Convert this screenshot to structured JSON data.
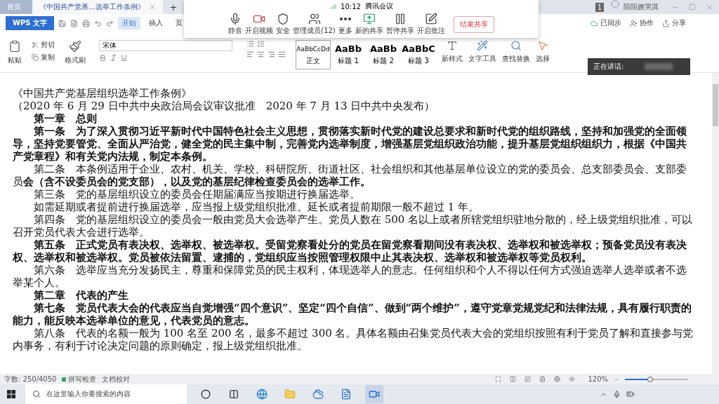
{
  "title_bar": {
    "tabs": [
      {
        "label": "首页",
        "selected": false
      },
      {
        "label": "《中国共产党基...选举工作条例》",
        "selected": true
      }
    ],
    "new_tab": "+",
    "notification_count": "1",
    "user_name": "陌陌嫂哭淇"
  },
  "ribbon": {
    "app_menu": "WPS 文字",
    "tabs": [
      {
        "label": "开始",
        "selected": true
      },
      {
        "label": "插入",
        "selected": false
      },
      {
        "label": "页",
        "selected": false
      }
    ],
    "cloud_actions": [
      {
        "label": "已同步",
        "kind": "sync"
      },
      {
        "label": "协作",
        "kind": "collab"
      },
      {
        "label": "分享",
        "kind": "share"
      }
    ],
    "clipboard": {
      "paste": "粘贴",
      "cut": "剪切",
      "copy": "复制",
      "format_painter": "格式刷"
    },
    "font_name": "宋体",
    "styles": [
      {
        "preview": "AaBbCcDd",
        "label": "正文",
        "selected": true
      },
      {
        "preview": "AaBb",
        "label": "标题 1",
        "selected": false
      },
      {
        "preview": "AaBb",
        "label": "标题 2",
        "selected": false
      },
      {
        "preview": "AaBbC",
        "label": "标题 3",
        "selected": false
      }
    ],
    "tools": [
      {
        "label": "新样式",
        "kind": "style"
      },
      {
        "label": "文字工具",
        "kind": "text"
      },
      {
        "label": "查找替换",
        "kind": "find"
      },
      {
        "label": "选择",
        "kind": "select"
      }
    ]
  },
  "meeting": {
    "time": "10:12",
    "title": "腾讯会议",
    "buttons": [
      {
        "label": "静音",
        "kind": "mic"
      },
      {
        "label": "开启视频",
        "kind": "video"
      },
      {
        "label": "安全",
        "kind": "shield"
      },
      {
        "label": "管理成员(12)",
        "kind": "members"
      },
      {
        "label": "更多",
        "kind": "more"
      },
      {
        "label": "新的共享",
        "kind": "share"
      },
      {
        "label": "暂停共享",
        "kind": "pause"
      },
      {
        "label": "开启批注",
        "kind": "annotate"
      }
    ],
    "end_button": "结束共享"
  },
  "speaking": {
    "label": "正在讲话:"
  },
  "document": {
    "paragraphs": [
      {
        "text": "《中国共产党基层组织选举工作条例》",
        "bold": false,
        "indent": false
      },
      {
        "text": "（2020 年 6 月 29 日中共中央政治局会议审议批准　2020 年 7 月 13 日中共中央发布）",
        "bold": false,
        "indent": false
      },
      {
        "text": "第一章　总则",
        "bold": true,
        "indent": true
      },
      {
        "text": "第一条　为了深入贯彻习近平新时代中国特色社会主义思想，贯彻落实新时代党的建设总要求和新时代党的组织路线，坚持和加强党的全面领导，坚持党要管党、全面从严治党，健全党的民主集中制，完善党内选举制度，增强基层党组织政治功能，提升基层党组织组织力，根据《中国共产党章程》和有关党内法规，制定本条例。",
        "bold": true,
        "indent": true
      },
      {
        "text": "第二条　本条例适用于企业、农村、机关、学校、科研院所、街道社区、社会组织和其他基层单位设立的党的委员会、总支部委员会、支部委员**会（含不设委员会的党支部），以及党的基层纪律检查委员会的选举工作。**",
        "bold": false,
        "indent": true
      },
      {
        "text": "第三条　党的基层组织设立的委员会任期届满应当按期进行换届选举。",
        "bold": false,
        "indent": true
      },
      {
        "text": "如需延期或者提前进行换届选举，应当报上级党组织批准。延长或者提前期限一般不超过 1 年。",
        "bold": false,
        "indent": true
      },
      {
        "text": "第四条　党的基层组织设立的委员会一般由党员大会选举产生。党员人数在 500 名以上或者所辖党组织驻地分散的，经上级党组织批准，可以召开党员代表大会进行选举。",
        "bold": false,
        "indent": true
      },
      {
        "text": "第五条　正式党员有表决权、选举权、被选举权。受留党察看处分的党员在留党察看期间没有表决权、选举权和被选举权；预备党员没有表决权、选举权和被选举权。党员被依法留置、逮捕的，党组织应当按照管理权限中止其表决权、选举权和被选举权等党员权利。",
        "bold": true,
        "indent": true
      },
      {
        "text": "第六条　选举应当充分发扬民主，尊重和保障党员的民主权利，体现选举人的意志。任何组织和个人不得以任何方式强迫选举人选举或者不选举某个人。",
        "bold": false,
        "indent": true
      },
      {
        "text": "第二章　代表的产生",
        "bold": true,
        "indent": true
      },
      {
        "text": "第七条　党员代表大会的代表应当自觉增强“四个意识”、坚定“四个自信”、做到“两个维护”，遵守党章党规党纪和法律法规，具有履行职责的能力，能反映本选举单位的意见，代表党员的意志。",
        "bold": true,
        "indent": true
      },
      {
        "text": "第八条　代表的名额一般为 100 名至 200 名，最多不超过 300 名。具体名额由召集党员代表大会的党组织按照有利于党员了解和直接参与党内事务，有利于讨论决定问题的原则确定，报上级党组织批准。",
        "bold": false,
        "indent": true
      }
    ]
  },
  "status_bar": {
    "word_count": "字数: 250/4050",
    "spell_check": {
      "label": "拼写检查",
      "checked": true
    },
    "proofread": "文档校对",
    "zoom": "120%",
    "zoom_slider": {
      "level": 0.4
    }
  },
  "taskbar": {
    "search_placeholder": "在这里输入你要搜索的内容"
  }
}
